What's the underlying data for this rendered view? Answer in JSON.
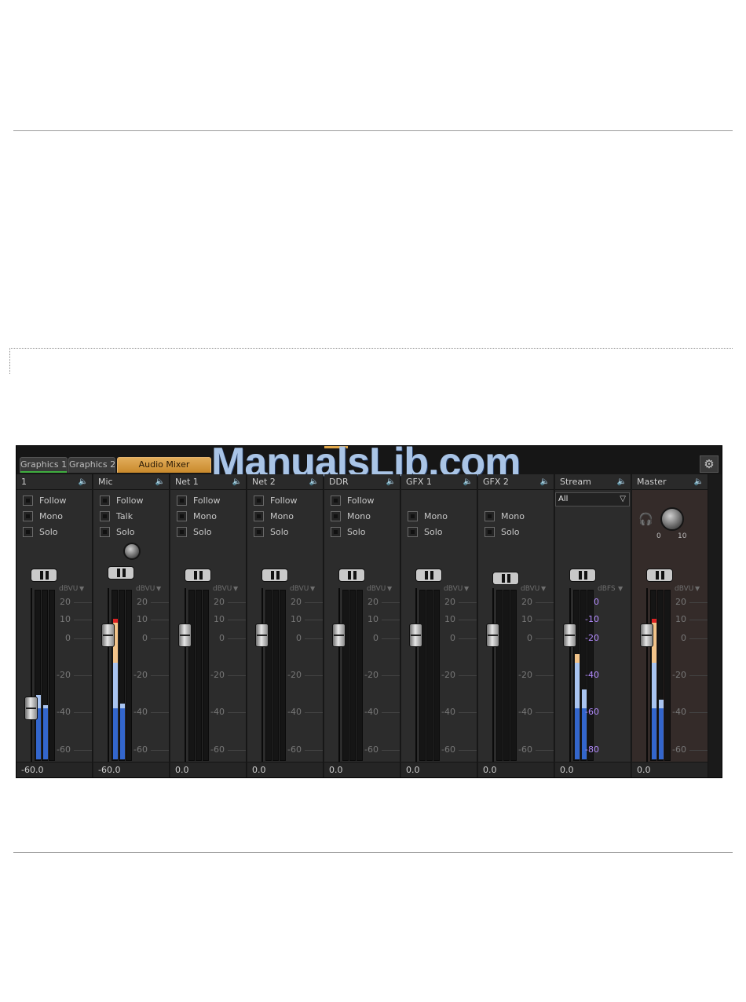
{
  "tabs": [
    {
      "label": "Graphics 1"
    },
    {
      "label": "Graphics 2"
    },
    {
      "label": "Audio Mixer"
    }
  ],
  "watermark": "ManualsLib.com",
  "icons": {
    "settings": "gear-icon",
    "mute": "speaker-icon",
    "headphones": "headphones-icon"
  },
  "colors": {
    "accent_tab": "#d9a04a",
    "meter_blue": "#3366cc",
    "meter_light": "#a9c4f0",
    "meter_orange": "#f3c48a",
    "meter_peak": "#dd2222",
    "stream_scale": "#b48cff"
  },
  "channels": [
    {
      "name": "1",
      "options": [
        "Follow",
        "Mono",
        "Solo"
      ],
      "value": "-60.0",
      "fader_level": 0.31,
      "meter": [
        0.38,
        0.32
      ]
    },
    {
      "name": "Mic",
      "options": [
        "Follow",
        "Talk",
        "Solo"
      ],
      "value": "-60.0",
      "fader_level": 0.73,
      "meter": [
        0.83,
        0.33
      ],
      "has_trim_knob": true
    },
    {
      "name": "Net 1",
      "options": [
        "Follow",
        "Mono",
        "Solo"
      ],
      "value": "0.0",
      "fader_level": 0.73,
      "meter": [
        0,
        0
      ]
    },
    {
      "name": "Net 2",
      "options": [
        "Follow",
        "Mono",
        "Solo"
      ],
      "value": "0.0",
      "fader_level": 0.73,
      "meter": [
        0,
        0
      ]
    },
    {
      "name": "DDR",
      "options": [
        "Follow",
        "Mono",
        "Solo"
      ],
      "value": "0.0",
      "fader_level": 0.73,
      "meter": [
        0,
        0
      ]
    },
    {
      "name": "GFX 1",
      "options": [
        "Mono",
        "Solo"
      ],
      "value": "0.0",
      "fader_level": 0.73,
      "meter": [
        0,
        0
      ]
    },
    {
      "name": "GFX 2",
      "options": [
        "Mono",
        "Solo"
      ],
      "value": "0.0",
      "fader_level": 0.73,
      "meter": [
        0,
        0
      ]
    },
    {
      "name": "Stream",
      "dropdown": "All",
      "value": "0.0",
      "fader_level": 0.73,
      "meter": [
        0.62,
        0.41
      ]
    },
    {
      "name": "Master",
      "value": "0.0",
      "fader_level": 0.73,
      "meter": [
        0.83,
        0.35
      ],
      "knob_min": "0",
      "knob_max": "10"
    }
  ],
  "scale": {
    "unit": "dBVU",
    "ticks": [
      "20",
      "10",
      "0",
      "-20",
      "-40",
      "-60"
    ]
  },
  "stream_scale": {
    "unit": "dBFS",
    "ticks": [
      "0",
      "-10",
      "-20",
      "-40",
      "-60",
      "-80"
    ]
  }
}
